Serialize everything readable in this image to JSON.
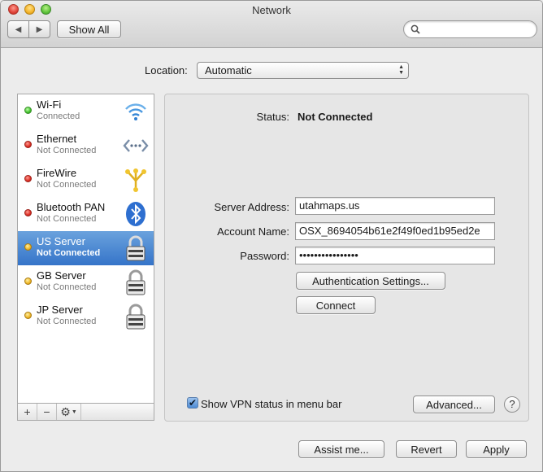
{
  "window": {
    "title": "Network"
  },
  "toolbar": {
    "show_all": "Show All",
    "back_icon": "chevron-left-icon",
    "forward_icon": "chevron-right-icon",
    "search_placeholder": ""
  },
  "location": {
    "label": "Location:",
    "value": "Automatic"
  },
  "services": [
    {
      "name": "Wi-Fi",
      "status": "Connected",
      "status_color": "green",
      "icon": "wifi-icon"
    },
    {
      "name": "Ethernet",
      "status": "Not Connected",
      "status_color": "red",
      "icon": "ethernet-icon"
    },
    {
      "name": "FireWire",
      "status": "Not Connected",
      "status_color": "red",
      "icon": "firewire-icon"
    },
    {
      "name": "Bluetooth PAN",
      "status": "Not Connected",
      "status_color": "red",
      "icon": "bluetooth-icon"
    },
    {
      "name": "US Server",
      "status": "Not Connected",
      "status_color": "yellow",
      "icon": "lock-icon",
      "selected": true
    },
    {
      "name": "GB Server",
      "status": "Not Connected",
      "status_color": "yellow",
      "icon": "lock-icon"
    },
    {
      "name": "JP Server",
      "status": "Not Connected",
      "status_color": "yellow",
      "icon": "lock-icon"
    }
  ],
  "sidebar_controls": {
    "add": "+",
    "remove": "−",
    "gear": "⚙"
  },
  "detail": {
    "status_label": "Status:",
    "status_value": "Not Connected",
    "server_address_label": "Server Address:",
    "server_address_value": "utahmaps.us",
    "account_name_label": "Account Name:",
    "account_name_value": "OSX_8694054b61e2f49f0ed1b95ed2e",
    "password_label": "Password:",
    "password_value": "••••••••••••••••",
    "auth_settings_button": "Authentication Settings...",
    "connect_button": "Connect",
    "show_vpn_status_label": "Show VPN status in menu bar",
    "show_vpn_status_checked": true,
    "advanced_button": "Advanced...",
    "help_button": "?"
  },
  "footer": {
    "assist_button": "Assist me...",
    "revert_button": "Revert",
    "apply_button": "Apply"
  },
  "colors": {
    "selection": "#3574c9",
    "window_bg": "#ececec"
  }
}
